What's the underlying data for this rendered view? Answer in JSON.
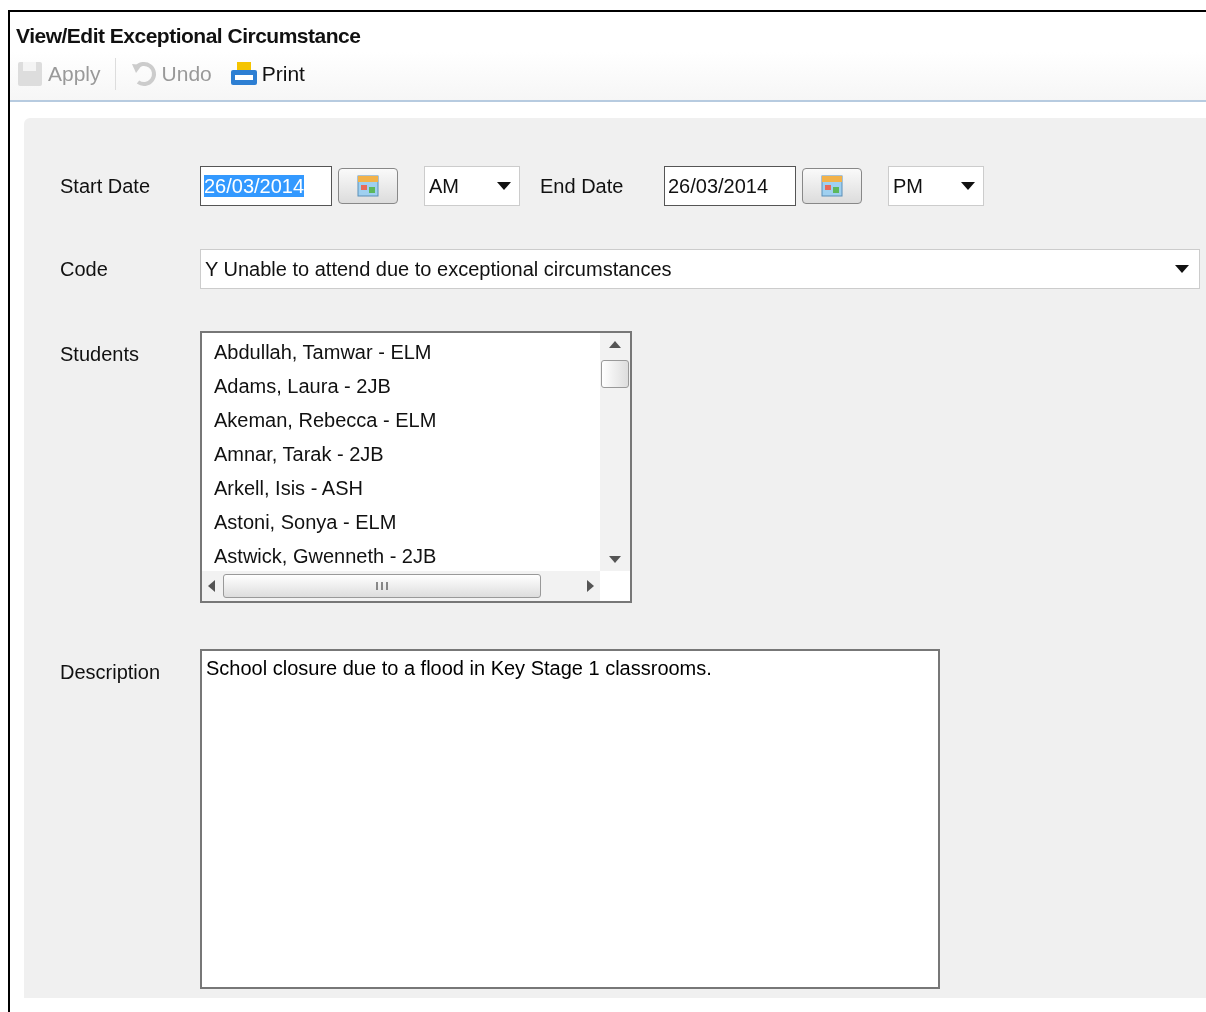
{
  "window": {
    "title": "View/Edit Exceptional Circumstance"
  },
  "toolbar": [
    {
      "kind": "save",
      "label": "Apply",
      "disabled": true
    },
    {
      "kind": "undo",
      "label": "Undo",
      "disabled": true
    },
    {
      "kind": "print",
      "label": "Print",
      "disabled": false
    }
  ],
  "start_date": {
    "label": "Start Date",
    "value": "26/03/2014",
    "text_selected": true,
    "session": "AM"
  },
  "end_date": {
    "label": "End Date",
    "value": "26/03/2014",
    "text_selected": false,
    "session": "PM"
  },
  "code": {
    "label": "Code",
    "value": "Y Unable to attend due to exceptional circumstances"
  },
  "students": {
    "label": "Students",
    "items": [
      "Abdullah, Tamwar - ELM",
      "Adams, Laura - 2JB",
      "Akeman, Rebecca - ELM",
      "Amnar, Tarak - 2JB",
      "Arkell, Isis - ASH",
      "Astoni, Sonya - ELM",
      "Astwick, Gwenneth - 2JB"
    ]
  },
  "description": {
    "label": "Description",
    "value": "School closure due to a flood in Key Stage 1 classrooms."
  }
}
